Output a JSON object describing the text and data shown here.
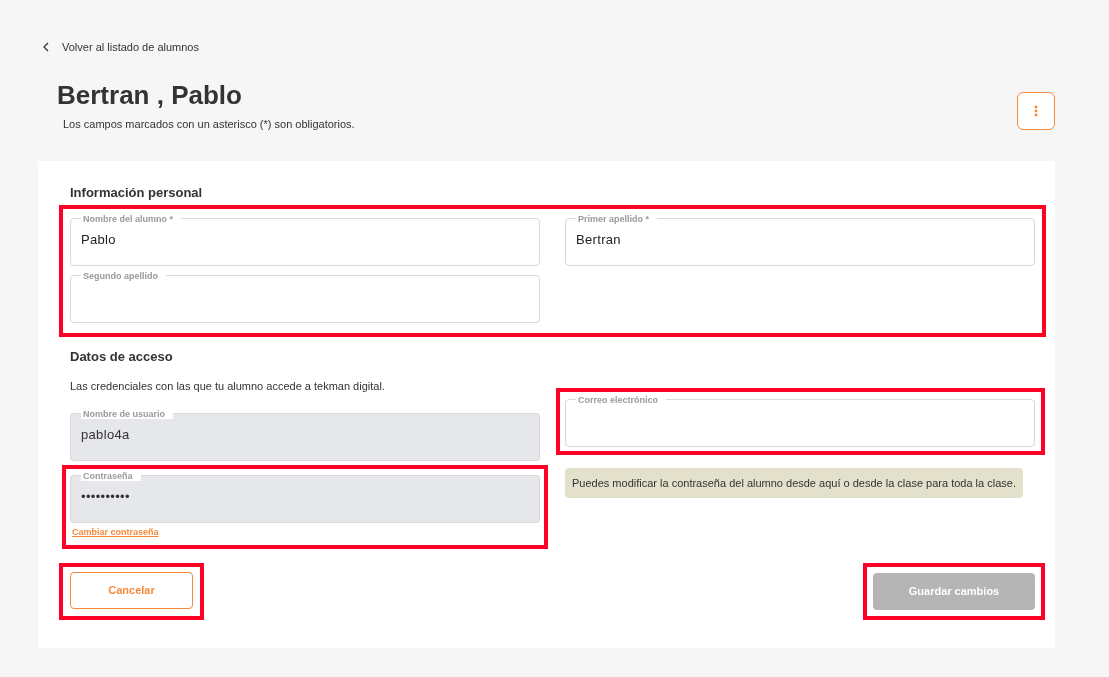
{
  "back_link": {
    "label": "Volver al listado de alumnos"
  },
  "title": "Bertran , Pablo",
  "subtitle": "Los campos marcados con un asterisco (*) son obligatorios.",
  "personal": {
    "heading": "Información personal",
    "highlighted": true,
    "fields": [
      {
        "label": "Nombre del alumno *",
        "value": "Pablo",
        "disabled": false
      },
      {
        "label": "Primer apellido *",
        "value": "Bertran",
        "disabled": false
      },
      {
        "label": "Segundo apellido",
        "disabled": false
      }
    ]
  },
  "access": {
    "heading": "Datos de acceso",
    "description": "Las credenciales con las que tu alumno accede a tekman digital.",
    "username": {
      "label": "Nombre de usuario",
      "value": "pablo4a",
      "disabled": true
    },
    "password": {
      "label": "Contraseña",
      "value": "••••••••••",
      "disabled": true,
      "highlighted": true,
      "link": "Cambiar contraseña"
    },
    "email": {
      "label": "Correo electrónico",
      "disabled": false,
      "highlighted": true
    },
    "note": "Puedes modificar la contraseña del alumno desde aquí o desde la clase para toda la clase."
  },
  "buttons": {
    "cancel": {
      "label": "Cancelar",
      "highlighted": true
    },
    "save": {
      "label": "Guardar cambios",
      "disabled": true,
      "highlighted": true
    }
  }
}
